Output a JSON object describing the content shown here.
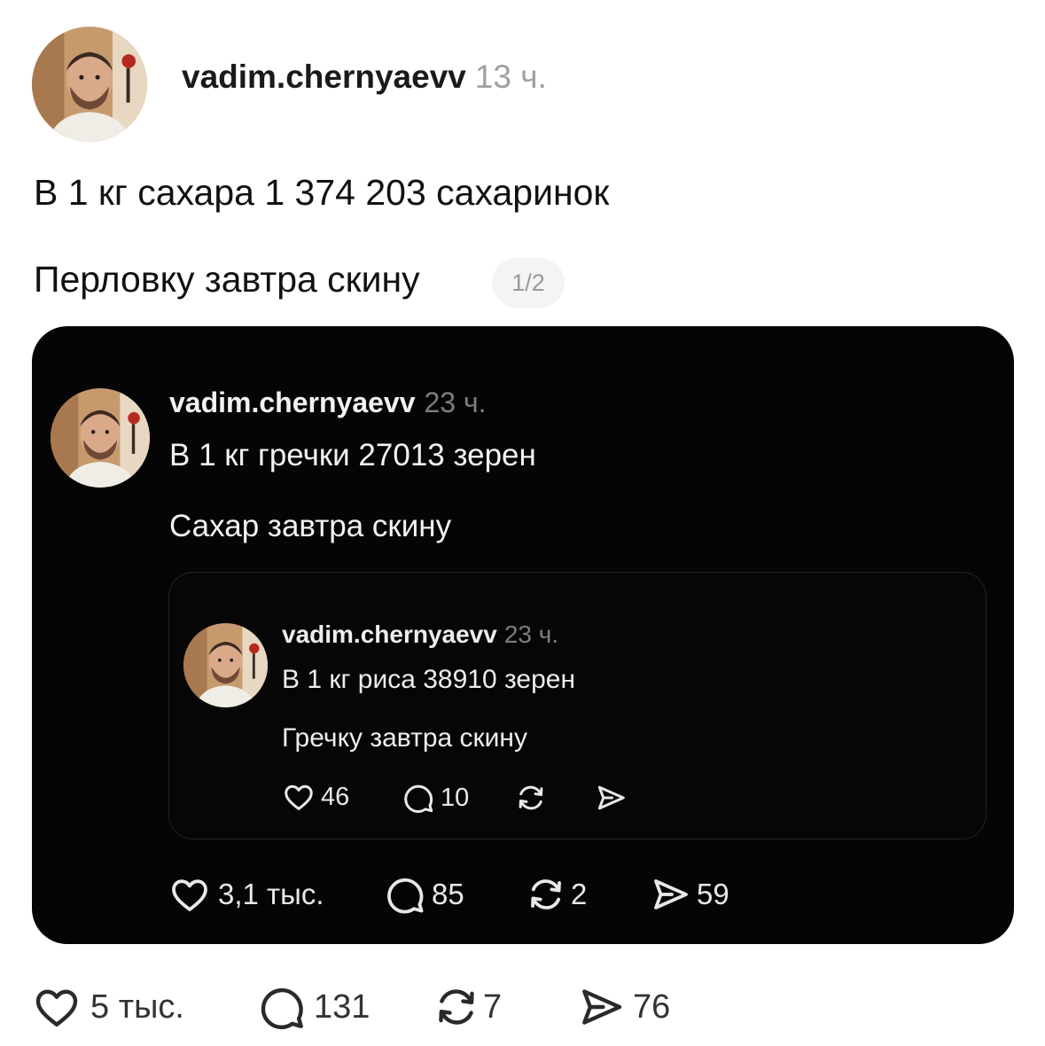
{
  "outer_post": {
    "username": "vadim.chernyaevv",
    "time": "13 ч.",
    "line1": "В 1 кг сахара 1 374 203 сахаринок",
    "line2": "Перловку завтра скину",
    "page_indicator": "1/2",
    "actions": {
      "likes": "5 тыс.",
      "comments": "131",
      "reposts": "7",
      "shares": "76"
    }
  },
  "quote_1": {
    "username": "vadim.chernyaevv",
    "time": "23 ч.",
    "line1": "В 1 кг гречки 27013 зерен",
    "line2": "Сахар завтра скину",
    "actions": {
      "likes": "3,1 тыс.",
      "comments": "85",
      "reposts": "2",
      "shares": "59"
    }
  },
  "quote_2": {
    "username": "vadim.chernyaevv",
    "time": "23 ч.",
    "line1": "В 1 кг риса 38910 зерен",
    "line2": "Гречку завтра скину",
    "actions": {
      "likes": "46",
      "comments": "10",
      "reposts": "",
      "shares": ""
    }
  },
  "icons": [
    "heart-icon",
    "comment-icon",
    "repost-icon",
    "share-icon"
  ],
  "colors": {
    "page_bg": "#ffffff",
    "card_bg": "#050505",
    "muted": "#a0a0a0"
  }
}
